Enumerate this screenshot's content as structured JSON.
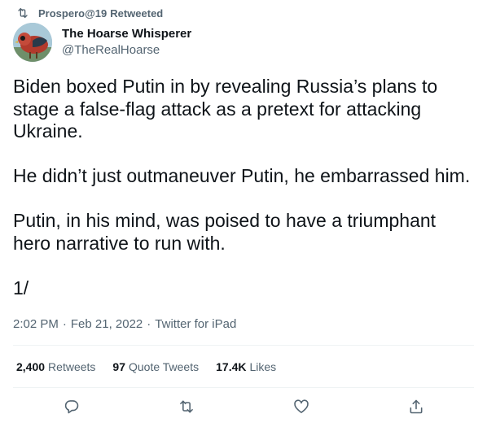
{
  "retweet_context": {
    "user": "Prospero@19",
    "label": "Retweeted"
  },
  "author": {
    "name": "The Hoarse Whisperer",
    "handle": "@TheRealHoarse"
  },
  "tweet": {
    "paragraphs": [
      "Biden boxed Putin in by revealing Russia’s plans to stage a false-flag attack as a pretext for attacking Ukraine.",
      "He didn’t just outmaneuver Putin, he embarrassed him.",
      "Putin, in his mind, was poised to have a triumphant hero narrative to run with.",
      "1/"
    ]
  },
  "meta": {
    "time": "2:02 PM",
    "separator": "·",
    "date": "Feb 21, 2022",
    "source": "Twitter for iPad"
  },
  "stats": {
    "retweets_count": "2,400",
    "retweets_label": "Retweets",
    "quotes_count": "97",
    "quotes_label": "Quote Tweets",
    "likes_count": "17.4K",
    "likes_label": "Likes"
  },
  "icons": {
    "retweet_context": "retweet-icon",
    "reply": "reply-icon",
    "retweet": "retweet-icon",
    "like": "heart-icon",
    "share": "share-icon"
  },
  "colors": {
    "text_primary": "#0f1419",
    "text_secondary": "#536471",
    "divider": "#eff3f4"
  }
}
